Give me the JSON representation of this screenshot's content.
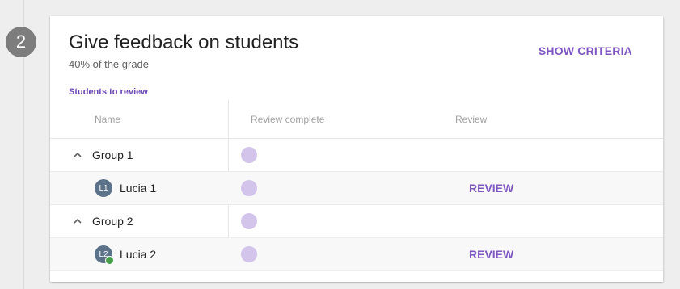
{
  "step": {
    "number": "2"
  },
  "card": {
    "title": "Give feedback on students",
    "subtitle": "40% of the grade",
    "show_criteria": "SHOW CRITERIA"
  },
  "section": {
    "label": "Students to review"
  },
  "table": {
    "columns": [
      "Name",
      "Review complete",
      "Review"
    ],
    "rows": [
      {
        "type": "group",
        "label": "Group 1",
        "expanded": true,
        "icon": "chevron-up-icon",
        "review_complete": false
      },
      {
        "type": "student",
        "avatar_initials": "L1",
        "label": "Lucia 1",
        "review_complete": false,
        "action": "REVIEW",
        "online": false
      },
      {
        "type": "group",
        "label": "Group 2",
        "expanded": true,
        "icon": "chevron-up-icon",
        "review_complete": false
      },
      {
        "type": "student",
        "avatar_initials": "L2",
        "label": "Lucia 2",
        "review_complete": false,
        "action": "REVIEW",
        "online": true
      }
    ]
  },
  "colors": {
    "accent": "#7e57c2",
    "status_incomplete": "#d3c4ec",
    "avatar": "#5b7288",
    "online": "#43a047",
    "step_badge": "#7d7d7d"
  }
}
